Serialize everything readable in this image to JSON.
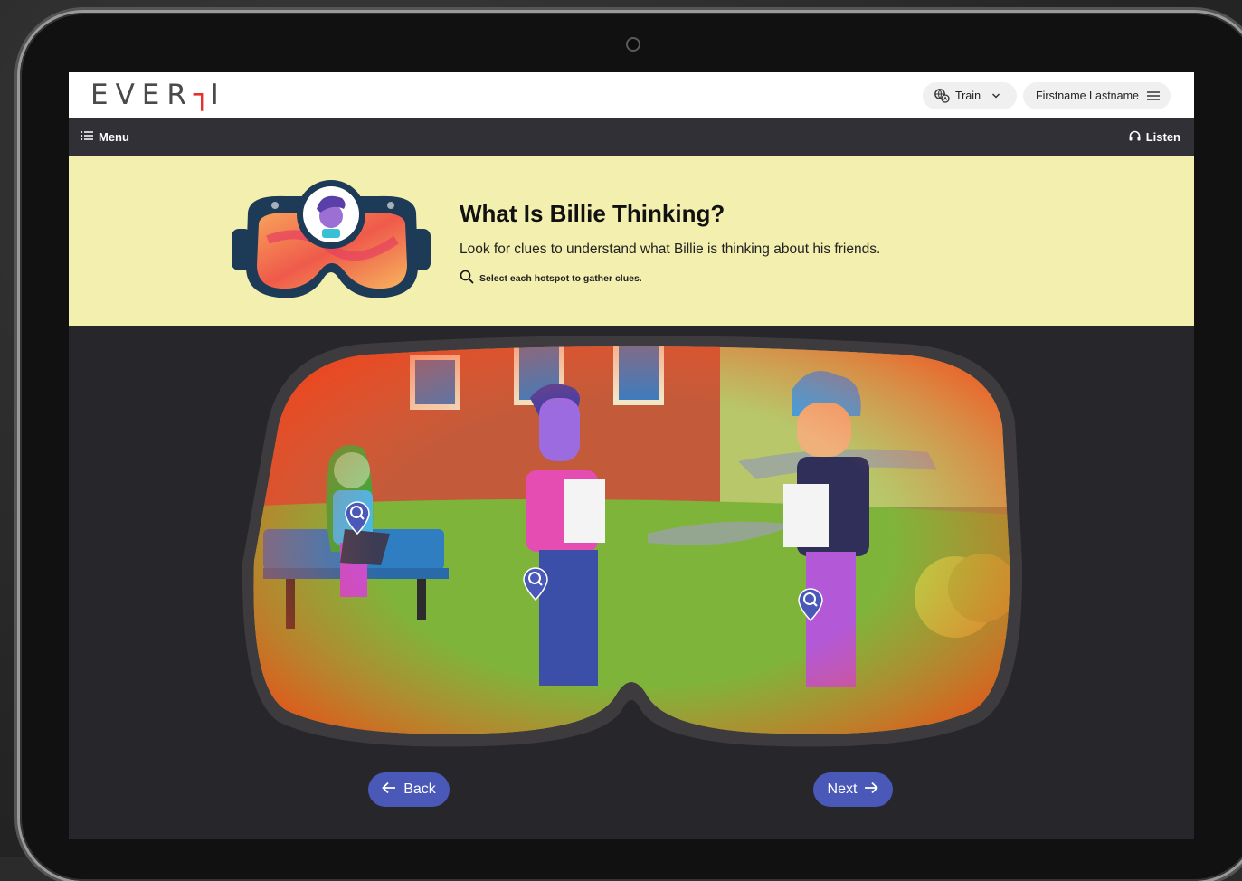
{
  "brand": {
    "logo_text_a": "EVER",
    "logo_text_b": "FI",
    "accent_color": "#e4332d"
  },
  "header": {
    "language_pill": {
      "label": "Train",
      "icon": "translate-icon",
      "caret": "chevron-down-icon"
    },
    "user_pill": {
      "label": "Firstname Lastname",
      "icon": "hamburger-icon"
    }
  },
  "navbar": {
    "menu_label": "Menu",
    "listen_label": "Listen"
  },
  "banner": {
    "title": "What Is Billie Thinking?",
    "description": "Look for clues to understand what Billie is thinking about his friends.",
    "hint": "Select each hotspot to gather clues.",
    "background": "#f3efae"
  },
  "scene": {
    "hotspots": [
      {
        "label": "Girl with laptop hotspot"
      },
      {
        "label": "Billie hotspot"
      },
      {
        "label": "Friend with paper hotspot"
      }
    ]
  },
  "footer": {
    "back_label": "Back",
    "next_label": "Next",
    "button_color": "#4a58b8"
  }
}
